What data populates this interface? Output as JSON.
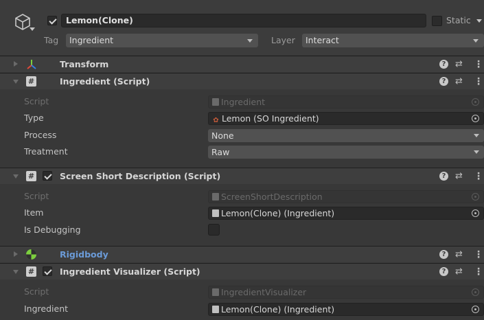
{
  "header": {
    "object_name": "Lemon(Clone)",
    "active": true,
    "static_label": "Static",
    "tag_label": "Tag",
    "tag_value": "Ingredient",
    "layer_label": "Layer",
    "layer_value": "Interact"
  },
  "components": [
    {
      "title": "Transform",
      "expanded": false,
      "icon": "transform-icon"
    },
    {
      "title": "Ingredient (Script)",
      "expanded": true,
      "icon": "script-icon",
      "properties": [
        {
          "label": "Script",
          "value": "Ingredient",
          "kind": "object",
          "disabled": true
        },
        {
          "label": "Type",
          "value": "Lemon (SO Ingredient)",
          "kind": "object",
          "disabled": false
        },
        {
          "label": "Process",
          "value": "None",
          "kind": "enum"
        },
        {
          "label": "Treatment",
          "value": "Raw",
          "kind": "enum"
        }
      ]
    },
    {
      "title": "Screen Short Description (Script)",
      "expanded": true,
      "enabled": true,
      "icon": "script-icon",
      "properties": [
        {
          "label": "Script",
          "value": "ScreenShortDescription",
          "kind": "object",
          "disabled": true
        },
        {
          "label": "Item",
          "value": "Lemon(Clone) (Ingredient)",
          "kind": "object",
          "disabled": false
        },
        {
          "label": "Is Debugging",
          "value": false,
          "kind": "bool"
        }
      ]
    },
    {
      "title": "Rigidbody",
      "expanded": false,
      "icon": "rigidbody-icon"
    },
    {
      "title": "Ingredient Visualizer (Script)",
      "expanded": true,
      "enabled": true,
      "icon": "script-icon",
      "properties": [
        {
          "label": "Script",
          "value": "IngredientVisualizer",
          "kind": "object",
          "disabled": true
        },
        {
          "label": "Ingredient",
          "value": "Lemon(Clone) (Ingredient)",
          "kind": "object",
          "disabled": false
        }
      ]
    }
  ],
  "icons": {
    "help": "?",
    "preset": "⇄",
    "menu": "⋮",
    "script": "#"
  },
  "colors": {
    "background": "#383838",
    "header_row": "#3e3e3e",
    "rigidbody_title": "#6b9bd8",
    "field": "#2a2a2a",
    "dropdown": "#515151"
  }
}
